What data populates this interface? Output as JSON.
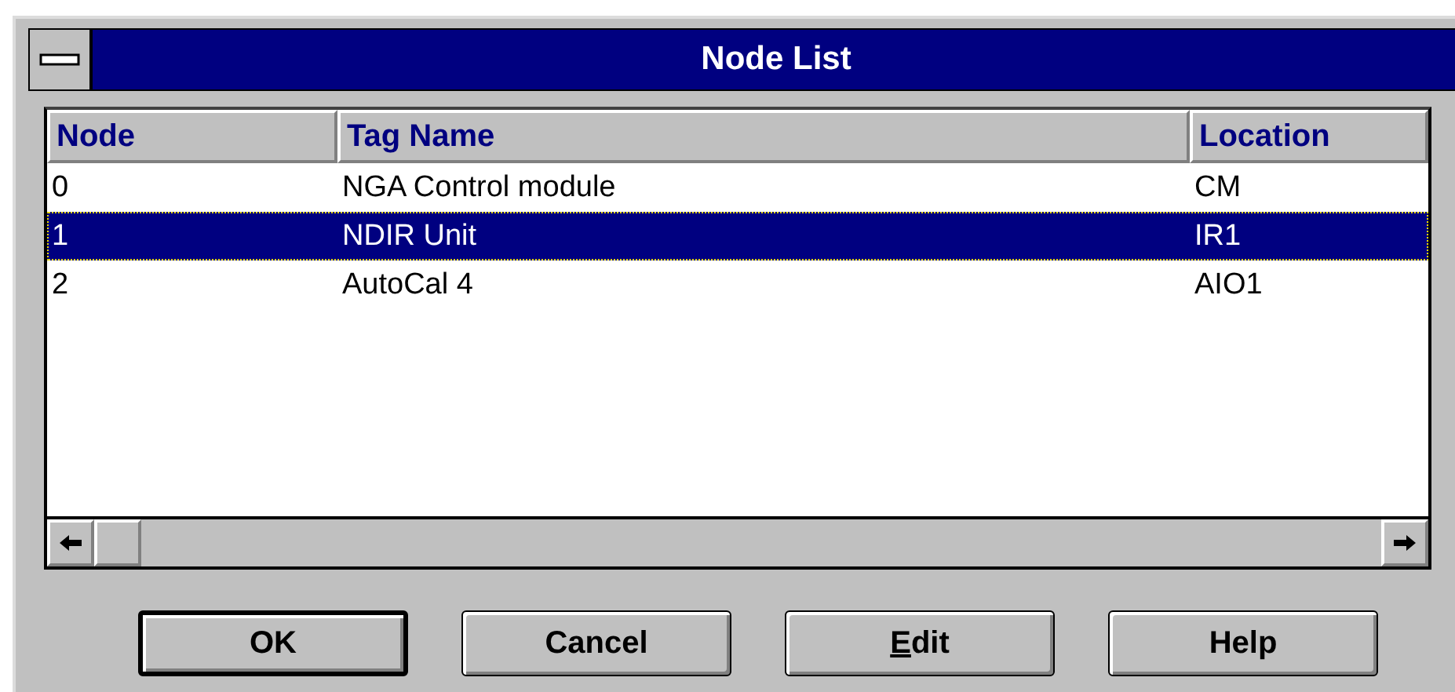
{
  "window": {
    "title": "Node List"
  },
  "table": {
    "columns": [
      "Node",
      "Tag Name",
      "Location"
    ],
    "rows": [
      {
        "cells": [
          "0",
          "NGA Control module",
          "CM"
        ],
        "selected": false
      },
      {
        "cells": [
          "1",
          "NDIR Unit",
          "IR1"
        ],
        "selected": true
      },
      {
        "cells": [
          "2",
          "AutoCal 4",
          "AIO1"
        ],
        "selected": false
      }
    ]
  },
  "buttons": [
    {
      "label": "OK",
      "default": true,
      "underline_first": false
    },
    {
      "label": "Cancel",
      "default": false,
      "underline_first": false
    },
    {
      "label": "Edit",
      "default": false,
      "underline_first": true
    },
    {
      "label": "Help",
      "default": false,
      "underline_first": false
    }
  ]
}
